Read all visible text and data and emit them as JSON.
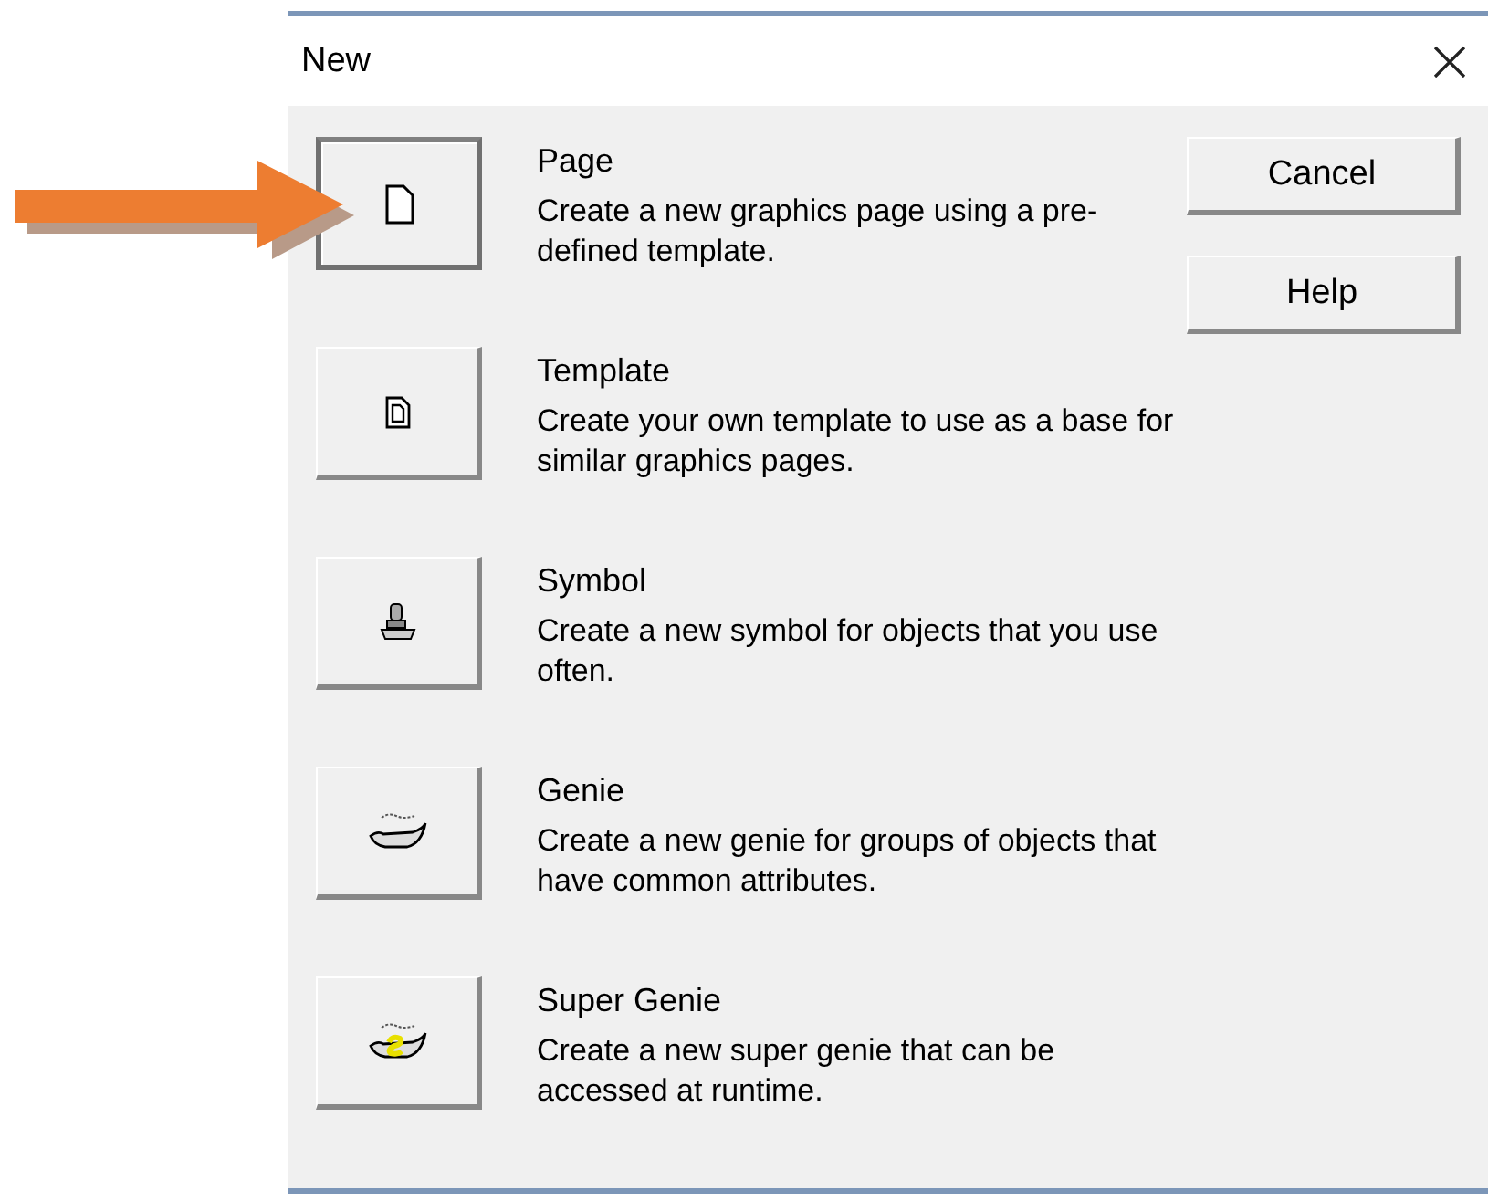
{
  "window": {
    "title": "New"
  },
  "items": [
    {
      "kind": "page",
      "title": "Page",
      "description": "Create a new graphics page using a pre-defined template.",
      "selected": true
    },
    {
      "kind": "template",
      "title": "Template",
      "description": "Create your own template to use as a base for similar graphics pages.",
      "selected": false
    },
    {
      "kind": "symbol",
      "title": "Symbol",
      "description": "Create a new symbol for objects that you use often.",
      "selected": false
    },
    {
      "kind": "genie",
      "title": "Genie",
      "description": "Create a new genie for groups of objects that have common attributes.",
      "selected": false
    },
    {
      "kind": "super_genie",
      "title": "Super Genie",
      "description": "Create a new super genie that can be accessed at runtime.",
      "selected": false
    }
  ],
  "buttons": [
    "Cancel",
    "Help"
  ]
}
